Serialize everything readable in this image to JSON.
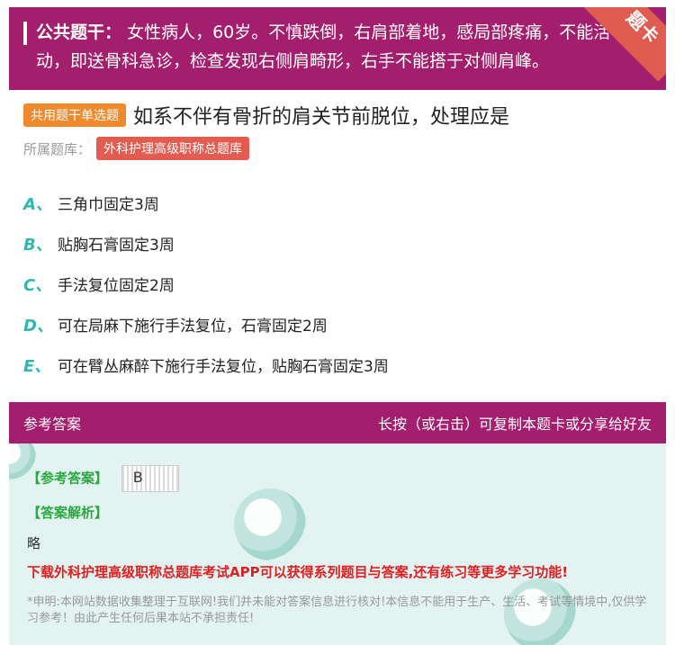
{
  "stem": {
    "title": "公共题干：",
    "text": "女性病人，60岁。不慎跌倒，右肩部着地，感局部疼痛，不能活动，即送骨科急诊，检查发现右侧肩畸形，右手不能搭于对侧肩峰。",
    "corner_label": "题卡"
  },
  "question": {
    "type_tag": "共用题干单选题",
    "text": "如系不伴有骨折的肩关节前脱位，处理应是",
    "bank_label": "所属题库：",
    "bank_name": "外科护理高级职称总题库"
  },
  "options": [
    {
      "letter": "A、",
      "text": "三角巾固定3周"
    },
    {
      "letter": "B、",
      "text": "贴胸石膏固定3周"
    },
    {
      "letter": "C、",
      "text": "手法复位固定2周"
    },
    {
      "letter": "D、",
      "text": "可在局麻下施行手法复位，石膏固定2周"
    },
    {
      "letter": "E、",
      "text": "可在臂丛麻醉下施行手法复位，贴胸石膏固定3周"
    }
  ],
  "answer": {
    "header_left": "参考答案",
    "header_right": "长按（或右击）可复制本题卡或分享给好友",
    "ref_label": "【参考答案】",
    "ref_value": "B",
    "analysis_label": "【答案解析】",
    "analysis_text": "略",
    "promo": "下载外科护理高级职称总题库考试APP可以获得系列题目与答案,还有练习等更多学习功能!",
    "disclaimer": "*申明:本网站数据收集整理于互联网!我们并未能对答案信息进行核对!本信息不能用于生产、生活、考试等情境中,仅供学习参考！由此产生任何后果本站不承担责任!"
  },
  "colors": {
    "header": "#a41e6e",
    "option_letter": "#2fb8b0",
    "type_tag": "#f08a2c",
    "bank_tag": "#e45b4f",
    "answer_bg": "#e3f3f1",
    "green_label": "#2aa840",
    "promo": "#e02020"
  }
}
